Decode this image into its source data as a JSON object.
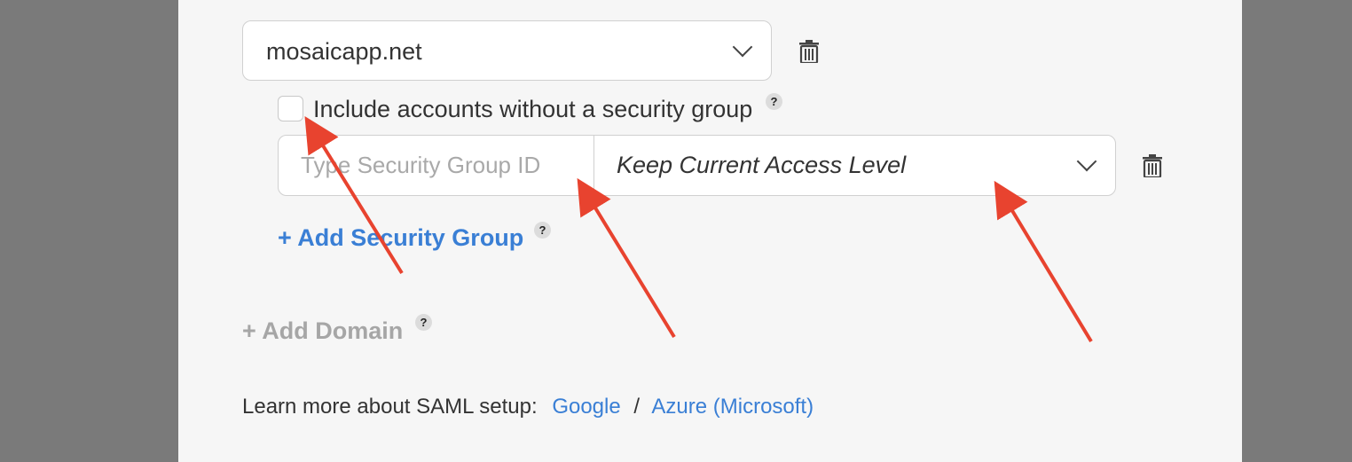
{
  "domain_select": {
    "value": "mosaicapp.net"
  },
  "include_checkbox": {
    "label": "Include accounts without a security group",
    "checked": false,
    "help": "?"
  },
  "security_group_row": {
    "id_placeholder": "Type Security Group ID",
    "id_value": "",
    "access_level": "Keep Current Access Level"
  },
  "add_security_group": {
    "label": "+ Add Security Group",
    "help": "?"
  },
  "add_domain": {
    "label": "+ Add Domain",
    "help": "?"
  },
  "learn_more": {
    "label": "Learn more about SAML setup:",
    "links": [
      "Google",
      "Azure (Microsoft)"
    ],
    "separator": "/"
  },
  "colors": {
    "link": "#3a7fd5",
    "muted_link": "#a6a6a6",
    "annotation_arrow": "#e8432f",
    "panel_bg": "#f6f6f6",
    "backdrop": "#7a7a7a"
  },
  "icons": [
    "chevron-down-icon",
    "trash-icon",
    "help-icon"
  ]
}
